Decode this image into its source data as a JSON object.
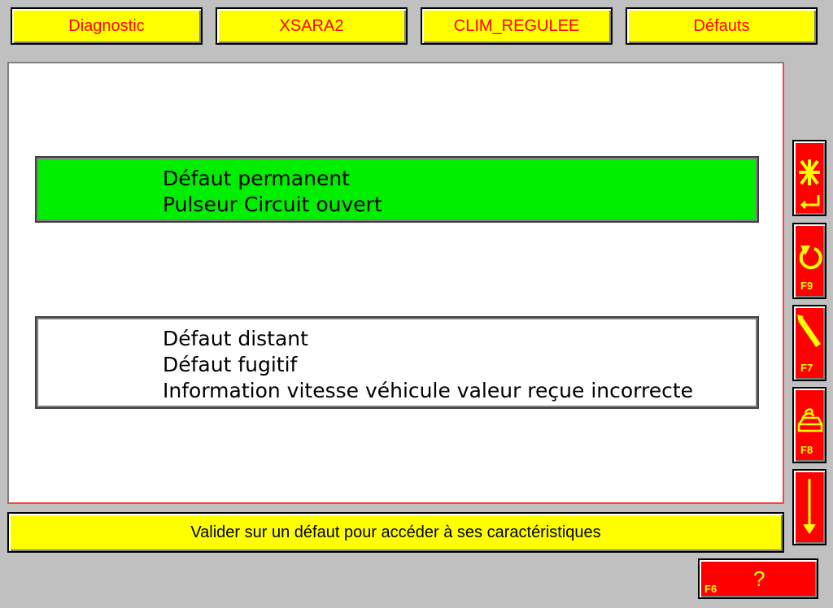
{
  "tabs": [
    {
      "label": "Diagnostic"
    },
    {
      "label": "XSARA2"
    },
    {
      "label": "CLIM_REGULEE"
    },
    {
      "label": "Défauts"
    }
  ],
  "faults": [
    {
      "lines": [
        "Défaut permanent",
        "Pulseur Circuit ouvert"
      ],
      "highlight": "#00ee00"
    },
    {
      "lines": [
        "Défaut distant",
        "Défaut fugitif",
        "Information vitesse véhicule valeur reçue incorrecte"
      ],
      "highlight": "#ffffff"
    }
  ],
  "side_buttons": [
    {
      "icon": "cancel-enter-icon",
      "key": ""
    },
    {
      "icon": "refresh-icon",
      "key": "F9"
    },
    {
      "icon": "pen-icon",
      "key": "F7"
    },
    {
      "icon": "print-icon",
      "key": "F8"
    },
    {
      "icon": "arrow-down-icon",
      "key": ""
    }
  ],
  "status": {
    "message": "Valider sur un défaut pour accéder à ses caractéristiques"
  },
  "help": {
    "symbol": "?",
    "key": "F6"
  },
  "colors": {
    "tab_bg": "#ffff00",
    "tab_text": "#ff0000",
    "selected": "#00ee00",
    "button_bg": "#ff0000",
    "button_icon": "#ffff00"
  }
}
